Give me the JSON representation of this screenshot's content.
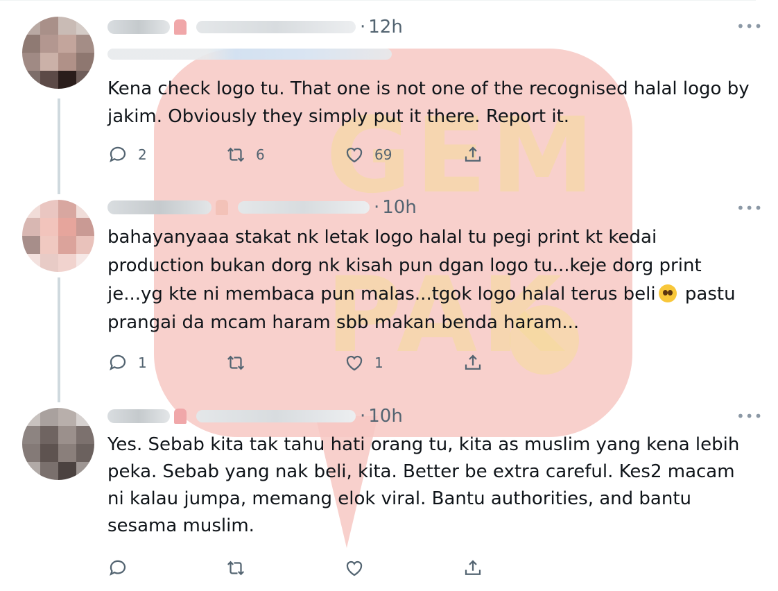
{
  "tweets": [
    {
      "time": "12h",
      "text": "Kena check logo tu. That one is not one of the recognised halal logo by jakim. Obviously they simply put it there. Report it.",
      "replies": "2",
      "retweets": "6",
      "likes": "69"
    },
    {
      "time": "10h",
      "text_before_emoji": "bahayanyaaa stakat nk letak logo halal tu pegi print kt kedai production bukan dorg nk kisah pun dgan logo tu...keje dorg print je...yg kte ni membaca pun malas...tgok logo halal terus beli",
      "text_after_emoji": " pastu prangai da mcam haram sbb makan benda haram...",
      "replies": "1",
      "retweets": "",
      "likes": "1"
    },
    {
      "time": "10h",
      "text": "Yes. Sebab kita tak tahu hati orang tu, kita as muslim yang kena lebih peka. Sebab yang nak beli, kita. Better be extra careful. Kes2 macam ni kalau jumpa, memang elok viral. Bantu authorities, and bantu sesama muslim.",
      "replies": "",
      "retweets": "",
      "likes": ""
    }
  ],
  "ui": {
    "dot": "·",
    "more": "•••"
  },
  "watermark": {
    "line1": "GEM",
    "line2": "PAK"
  },
  "icons": [
    "reply-icon",
    "retweet-icon",
    "like-icon",
    "share-icon",
    "more-icon",
    "pleading-face-emoji"
  ]
}
